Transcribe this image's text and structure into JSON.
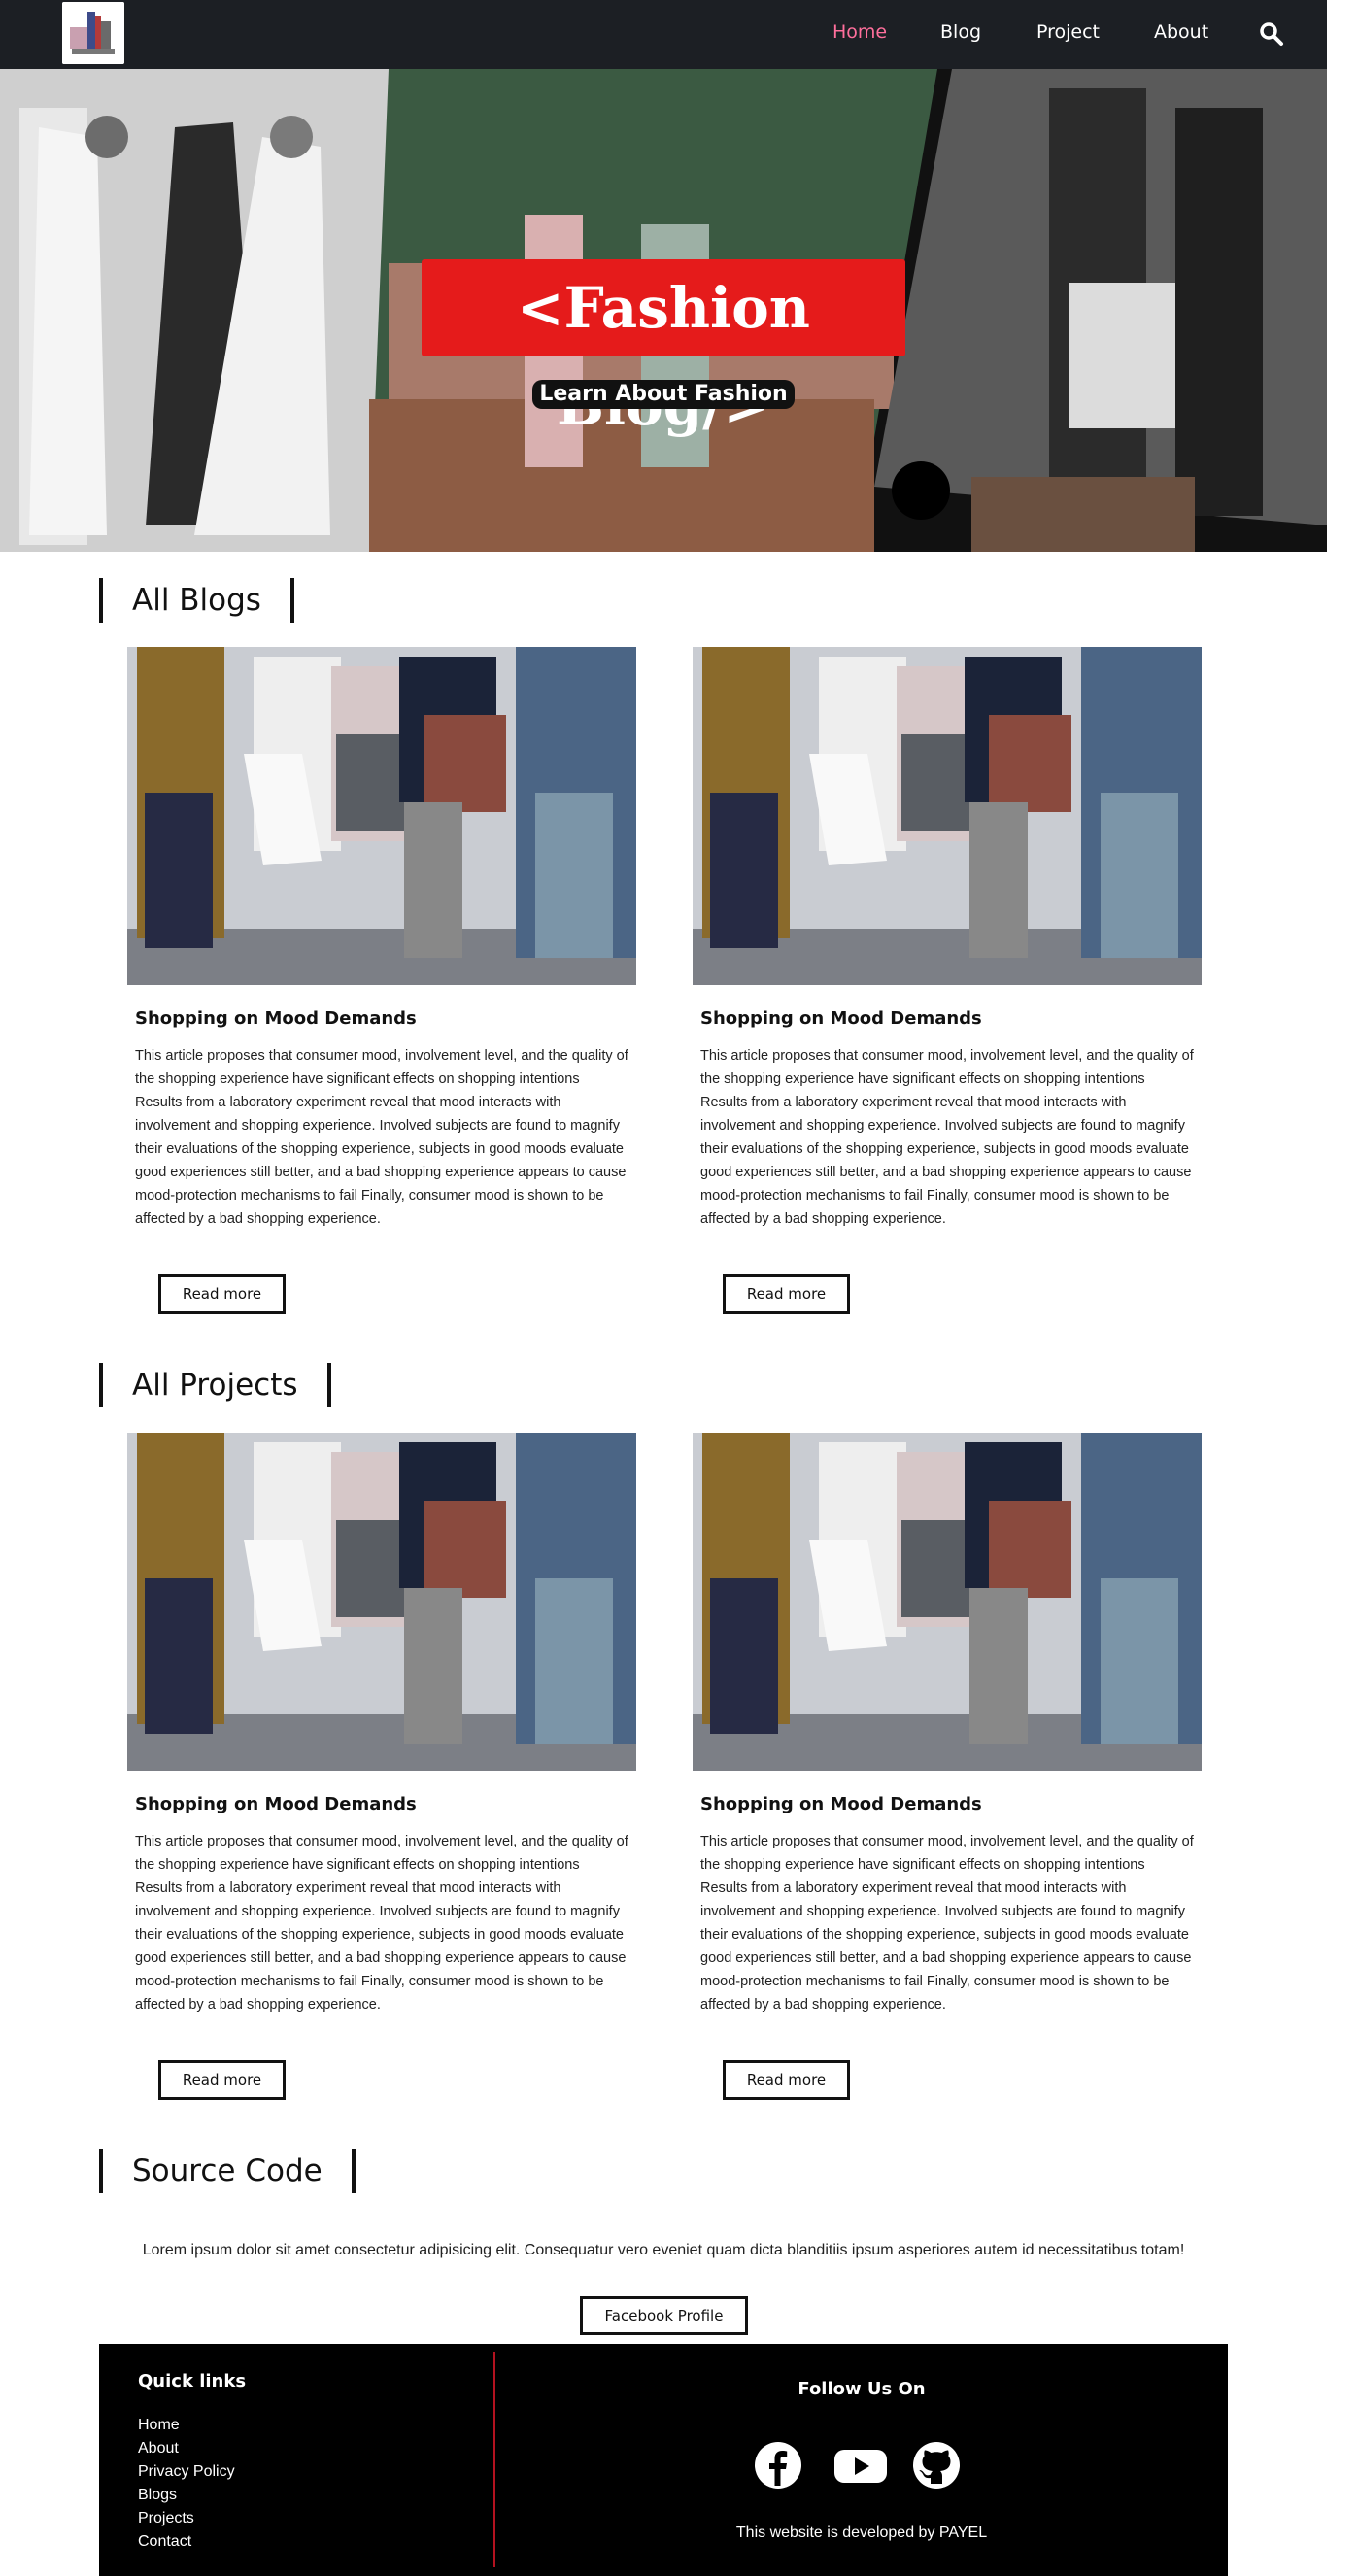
{
  "nav": {
    "links": [
      "Home",
      "Blog",
      "Project",
      "About"
    ],
    "active": "Home",
    "search_icon": "search-icon",
    "active_color": "#ff6f9c"
  },
  "hero": {
    "title": "<Fashion Blog/>",
    "subtitle": "Learn About Fashion",
    "title_bg": "#e51b1b"
  },
  "blogs": {
    "heading": "All Blogs",
    "cards": [
      {
        "title": "Shopping on Mood Demands",
        "body": "This article proposes that consumer mood, involvement level, and the quality of the shopping experience have significant effects on shopping intentions Results from a laboratory experiment reveal that mood interacts with involvement and shopping experience. Involved subjects are found to magnify their evaluations of the shopping experience, subjects in good moods evaluate good experiences still better, and a bad shopping experience appears to cause mood-protection mechanisms to fail Finally, consumer mood is shown to be affected by a bad shopping experience.",
        "button": "Read more"
      },
      {
        "title": "Shopping on Mood Demands",
        "body": "This article proposes that consumer mood, involvement level, and the quality of the shopping experience have significant effects on shopping intentions Results from a laboratory experiment reveal that mood interacts with involvement and shopping experience. Involved subjects are found to magnify their evaluations of the shopping experience, subjects in good moods evaluate good experiences still better, and a bad shopping experience appears to cause mood-protection mechanisms to fail Finally, consumer mood is shown to be affected by a bad shopping experience.",
        "button": "Read more"
      }
    ]
  },
  "projects": {
    "heading": "All Projects",
    "cards": [
      {
        "title": "Shopping on Mood Demands",
        "body": "This article proposes that consumer mood, involvement level, and the quality of the shopping experience have significant effects on shopping intentions Results from a laboratory experiment reveal that mood interacts with involvement and shopping experience. Involved subjects are found to magnify their evaluations of the shopping experience, subjects in good moods evaluate good experiences still better, and a bad shopping experience appears to cause mood-protection mechanisms to fail Finally, consumer mood is shown to be affected by a bad shopping experience.",
        "button": "Read more"
      },
      {
        "title": "Shopping on Mood Demands",
        "body": "This article proposes that consumer mood, involvement level, and the quality of the shopping experience have significant effects on shopping intentions Results from a laboratory experiment reveal that mood interacts with involvement and shopping experience. Involved subjects are found to magnify their evaluations of the shopping experience, subjects in good moods evaluate good experiences still better, and a bad shopping experience appears to cause mood-protection mechanisms to fail Finally, consumer mood is shown to be affected by a bad shopping experience.",
        "button": "Read more"
      }
    ]
  },
  "source": {
    "heading": "Source Code",
    "text": "Lorem ipsum dolor sit amet consectetur adipisicing elit. Consequatur vero eveniet quam dicta blanditiis ipsum asperiores autem id necessitatibus totam!",
    "button": "Facebook Profile"
  },
  "footer": {
    "quick_links_title": "Quick links",
    "links": [
      "Home",
      "About",
      "Privacy Policy",
      "Blogs",
      "Projects",
      "Contact"
    ],
    "follow_title": "Follow Us On",
    "social_icons": [
      "facebook-icon",
      "youtube-icon",
      "github-icon"
    ],
    "credit": "This website is developed by PAYEL"
  }
}
